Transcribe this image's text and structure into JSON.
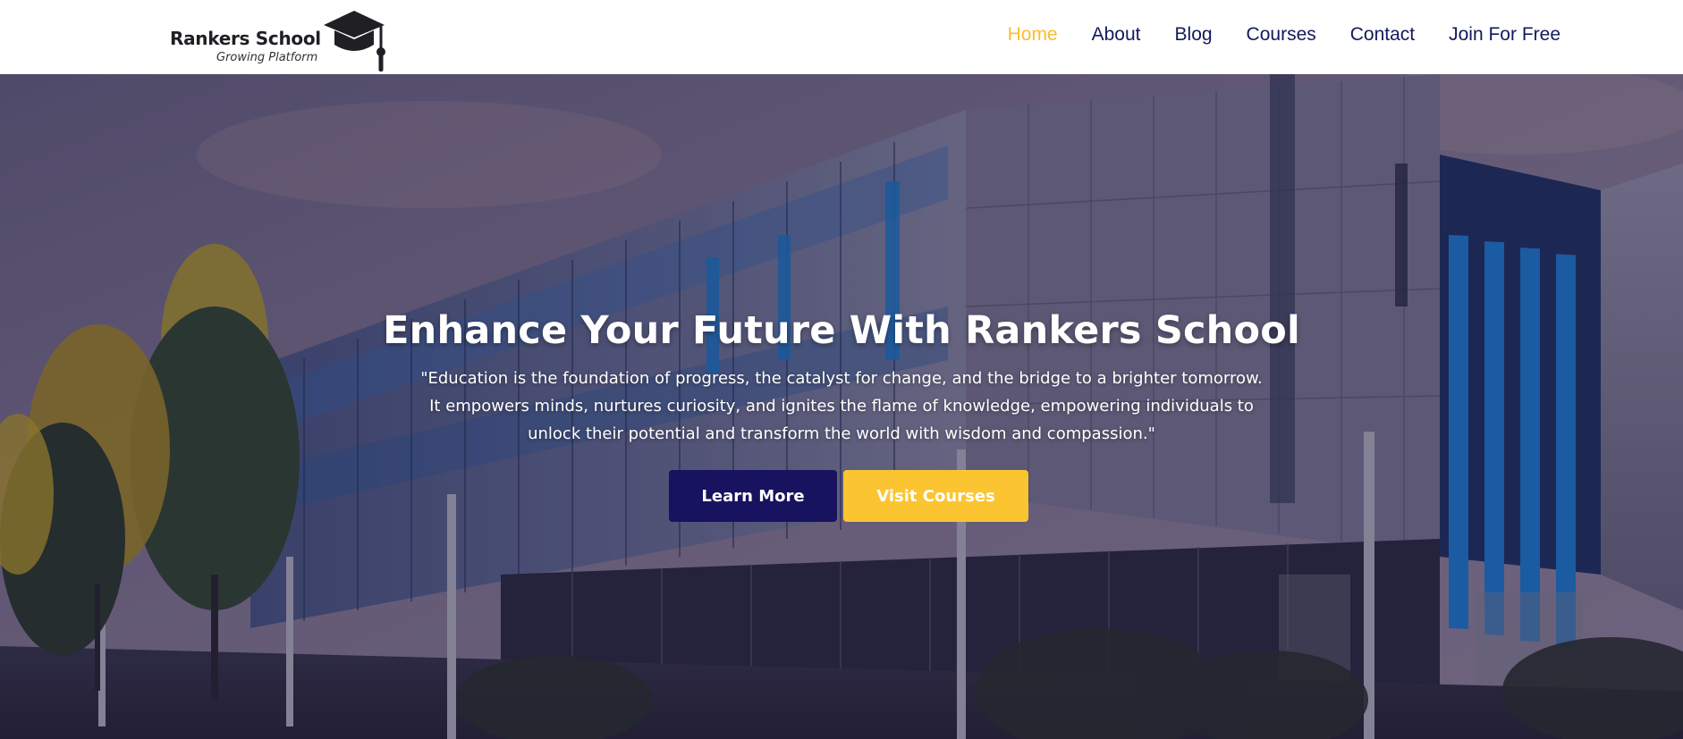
{
  "brand": {
    "name": "Rankers School",
    "tagline": "Growing Platform"
  },
  "nav": {
    "items": [
      {
        "label": "Home",
        "active": true
      },
      {
        "label": "About",
        "active": false
      },
      {
        "label": "Blog",
        "active": false
      },
      {
        "label": "Courses",
        "active": false
      },
      {
        "label": "Contact",
        "active": false
      },
      {
        "label": "Join For Free",
        "active": false
      }
    ]
  },
  "hero": {
    "title": "Enhance Your Future With Rankers School",
    "quote": "\"Education is the foundation of progress, the catalyst for change, and the bridge to a brighter tomorrow. It empowers minds, nurtures curiosity, and ignites the flame of knowledge, empowering individuals to unlock their potential and transform the world with wisdom and compassion.\"",
    "buttons": {
      "learn_more": "Learn More",
      "visit_courses": "Visit Courses"
    }
  },
  "colors": {
    "nav_active": "#f9be2b",
    "nav_text": "#121a5a",
    "primary_button": "#17135e",
    "accent_button": "#fbc531"
  },
  "icons": {
    "logo_icon": "graduation-cap-icon"
  }
}
